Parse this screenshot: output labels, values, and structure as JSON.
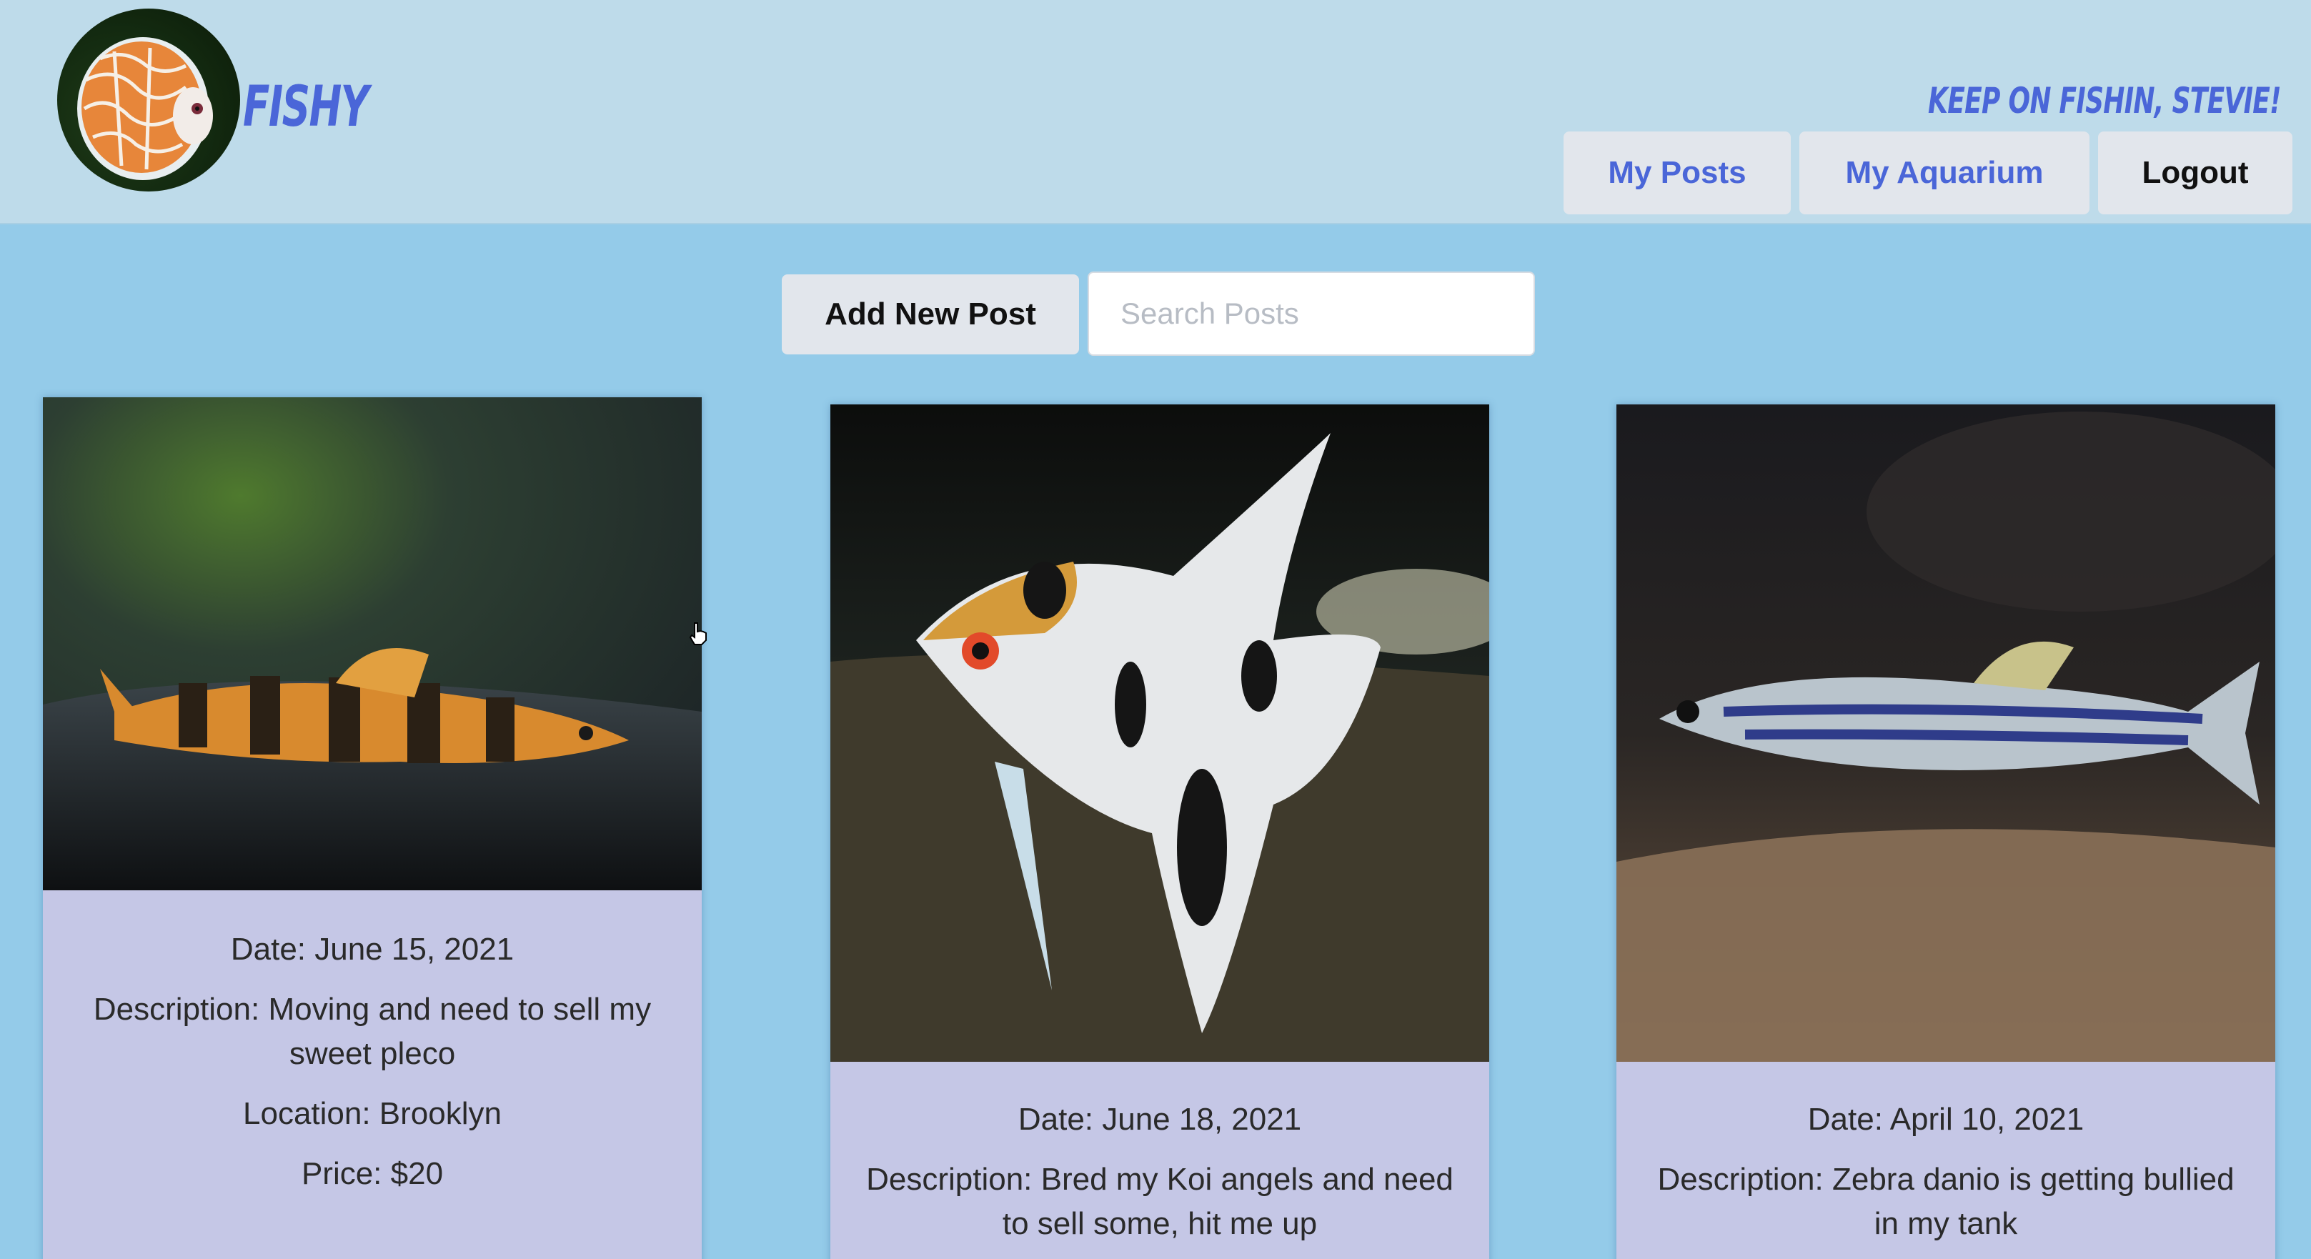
{
  "app": {
    "brand": "FISHY",
    "greeting": "KEEP ON FISHIN, STEVIE!"
  },
  "nav": {
    "my_posts": "My Posts",
    "my_aquarium": "My Aquarium",
    "logout": "Logout"
  },
  "toolbar": {
    "add_post_label": "Add New Post",
    "search_placeholder": "Search Posts",
    "search_value": ""
  },
  "colors": {
    "page_bg": "#94cbe9",
    "header_bg": "#bedbea",
    "accent": "#4a66d8",
    "card_bg": "#c5c7e6"
  },
  "posts": [
    {
      "subject": "pleco",
      "date": "Date: June 15, 2021",
      "description": "Description: Moving and need to sell my sweet pleco",
      "location": "Location: Brooklyn",
      "price": "Price: $20"
    },
    {
      "subject": "koi-angelfish",
      "date": "Date: June 18, 2021",
      "description": "Description: Bred my Koi angels and need to sell some, hit me up"
    },
    {
      "subject": "zebra-danio",
      "date": "Date: April 10, 2021",
      "description": "Description: Zebra danio is getting bullied in my tank"
    }
  ]
}
